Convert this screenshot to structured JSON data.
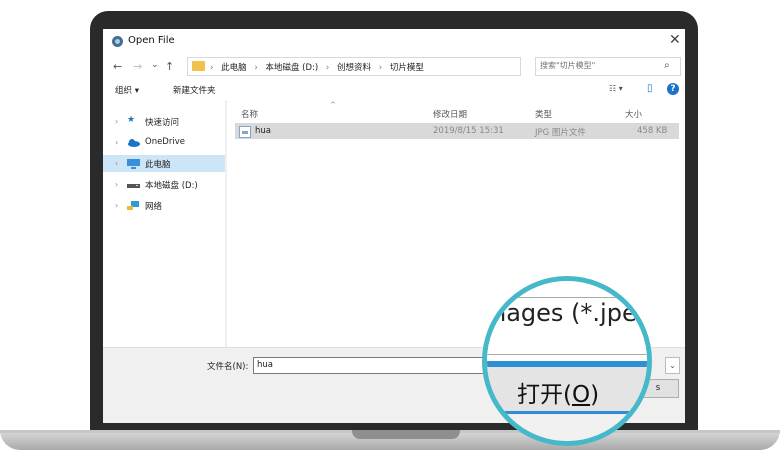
{
  "dialog": {
    "title": "Open File",
    "close_glyph": "✕"
  },
  "nav": {
    "back": "←",
    "forward": "→",
    "recent": "⌄",
    "up": "↑",
    "path": [
      "此电脑",
      "本地磁盘 (D:)",
      "创想资料",
      "切片模型"
    ],
    "path_sep": "›",
    "dropdown": "⌄",
    "refresh": "↻",
    "search_placeholder": "搜索\"切片模型\"",
    "search_icon": "⌕"
  },
  "toolbar": {
    "organize": "组织 ▾",
    "new_folder": "新建文件夹",
    "view_glyph": "☷ ▾",
    "pane_glyph": "▯",
    "help": "?"
  },
  "sidebar": {
    "items": [
      {
        "label": "快速访问",
        "icon": "star-icon",
        "color": "#1a73c9"
      },
      {
        "label": "OneDrive",
        "icon": "cloud-icon",
        "color": "#1a73c9"
      },
      {
        "label": "此电脑",
        "icon": "computer-icon",
        "color": "#3a8fd6"
      },
      {
        "label": "本地磁盘 (D:)",
        "icon": "drive-icon",
        "color": "#555555"
      },
      {
        "label": "网络",
        "icon": "network-icon",
        "color": "#2d9bd6"
      }
    ],
    "chevron": "›"
  },
  "columns": {
    "name": "名称",
    "date": "修改日期",
    "type": "类型",
    "size": "大小",
    "sort_glyph": "^"
  },
  "files": [
    {
      "name": "hua",
      "date": "2019/8/15 15:31",
      "type": "JPG 图片文件",
      "size": "458 KB"
    }
  ],
  "bottom": {
    "filename_label": "文件名(N):",
    "filename_value": "hua",
    "filetype_dropdown": "⌄",
    "cancel_peek": "s"
  },
  "magnifier": {
    "filetype_text": "nages (*.jpe",
    "open_text": "打开(",
    "open_mnemonic": "O",
    "open_close": ")"
  }
}
